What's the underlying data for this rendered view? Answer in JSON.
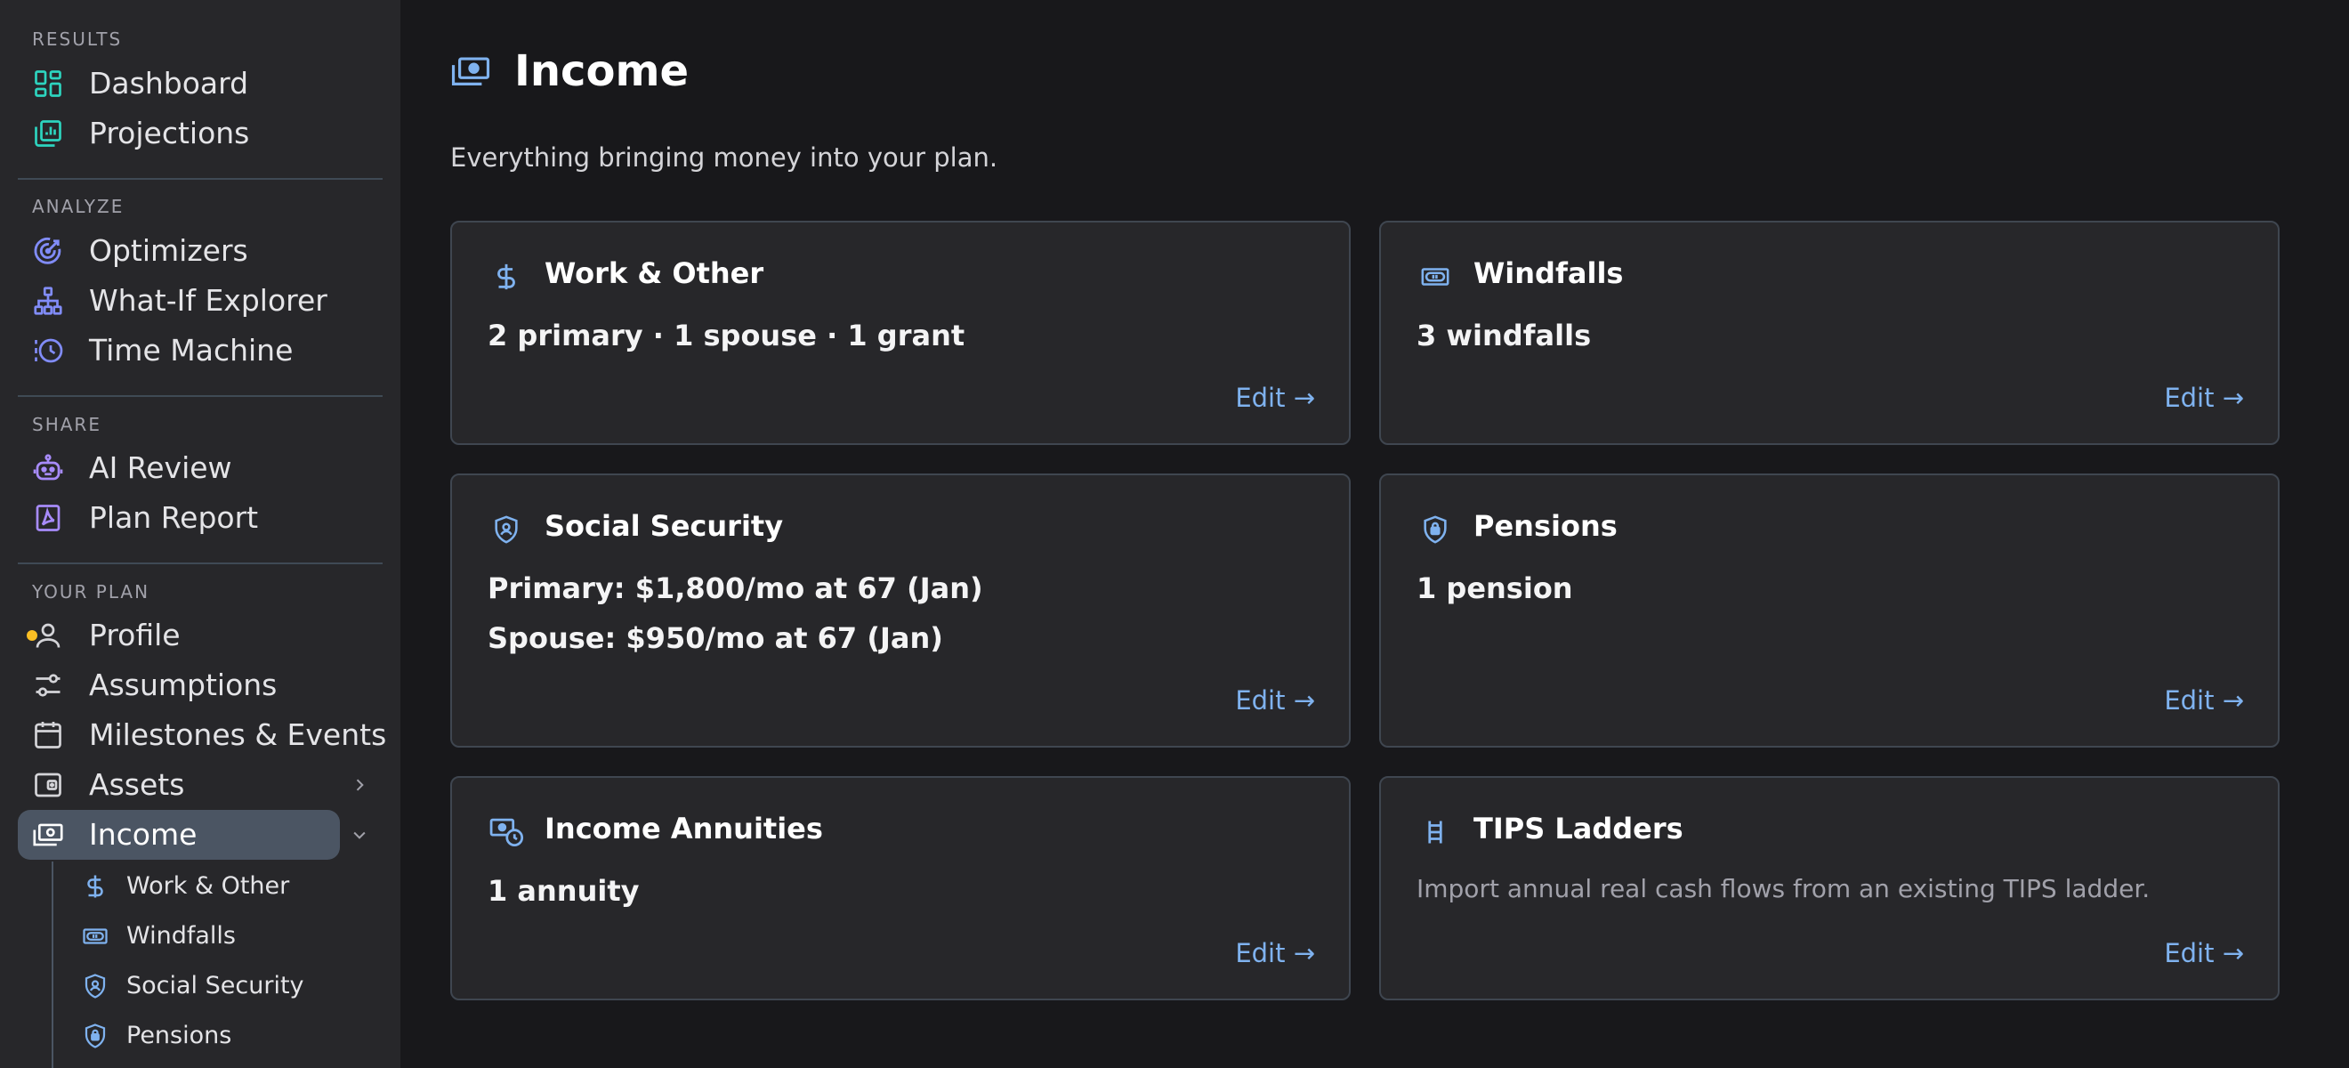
{
  "sidebar": {
    "sections": {
      "results": "RESULTS",
      "analyze": "ANALYZE",
      "share": "SHARE",
      "your_plan": "YOUR PLAN"
    },
    "items": {
      "dashboard": "Dashboard",
      "projections": "Projections",
      "optimizers": "Optimizers",
      "what_if": "What-If Explorer",
      "time_machine": "Time Machine",
      "ai_review": "AI Review",
      "plan_report": "Plan Report",
      "profile": "Profile",
      "assumptions": "Assumptions",
      "milestones": "Milestones & Events",
      "assets": "Assets",
      "income": "Income"
    },
    "sub_items": {
      "work_other": "Work & Other",
      "windfalls": "Windfalls",
      "social_security": "Social Security",
      "pensions": "Pensions"
    },
    "colors": {
      "results_icon": "#2dd4bf",
      "analyze_icon": "#818cf8",
      "share_icon": "#a78bfa",
      "plan_icon": "#d4d4d8",
      "profile_dot": "#fbbf24",
      "sub_icon": "#7fb2ef"
    }
  },
  "page": {
    "title": "Income",
    "subtitle": "Everything bringing money into your plan."
  },
  "cards": {
    "work_other": {
      "title": "Work & Other",
      "line1": "2 primary · 1 spouse · 1 grant",
      "edit": "Edit →"
    },
    "windfalls": {
      "title": "Windfalls",
      "line1": "3 windfalls",
      "edit": "Edit →"
    },
    "social_security": {
      "title": "Social Security",
      "line1": "Primary: $1,800/mo at 67 (Jan)",
      "line2": "Spouse: $950/mo at 67 (Jan)",
      "edit": "Edit →"
    },
    "pensions": {
      "title": "Pensions",
      "line1": "1 pension",
      "edit": "Edit →"
    },
    "income_annuities": {
      "title": "Income Annuities",
      "line1": "1 annuity",
      "edit": "Edit →"
    },
    "tips_ladders": {
      "title": "TIPS Ladders",
      "description": "Import annual real cash flows from an existing TIPS ladder.",
      "edit": "Edit →"
    }
  },
  "theme": {
    "accent": "#7fb2ef",
    "background": "#18181b",
    "panel": "#27272a"
  }
}
